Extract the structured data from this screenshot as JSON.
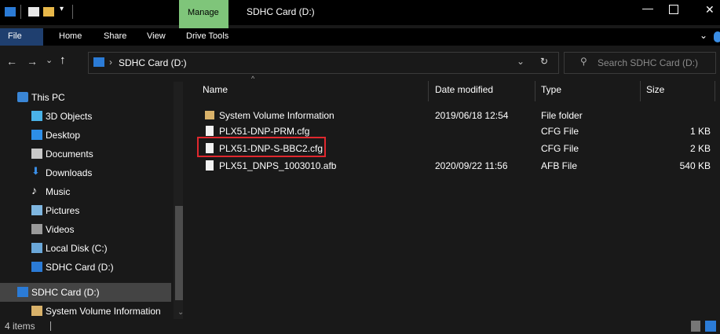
{
  "window": {
    "title": "SDHC Card (D:)",
    "manage_tab": "Manage",
    "drive_tools_tab": "Drive Tools"
  },
  "ribbon": {
    "tabs": [
      "File",
      "Home",
      "Share",
      "View"
    ]
  },
  "address": {
    "path": "SDHC Card (D:)",
    "search_placeholder": "Search SDHC Card (D:)"
  },
  "nav": {
    "this_pc": "This PC",
    "items": [
      "3D Objects",
      "Desktop",
      "Documents",
      "Downloads",
      "Music",
      "Pictures",
      "Videos",
      "Local Disk (C:)",
      "SDHC Card (D:)"
    ],
    "selected": "SDHC Card (D:)",
    "sub_item": "System Volume Information"
  },
  "columns": {
    "name": "Name",
    "date": "Date modified",
    "type": "Type",
    "size": "Size"
  },
  "files": [
    {
      "name": "System Volume Information",
      "date": "2019/06/18 12:54",
      "type": "File folder",
      "size": ""
    },
    {
      "name": "PLX51-DNP-PRM.cfg",
      "date": "",
      "type": "CFG File",
      "size": "1 KB"
    },
    {
      "name": "PLX51-DNP-S-BBC2.cfg",
      "date": "",
      "type": "CFG File",
      "size": "2 KB"
    },
    {
      "name": "PLX51_DNPS_1003010.afb",
      "date": "2020/09/22 11:56",
      "type": "AFB File",
      "size": "540 KB"
    }
  ],
  "status": {
    "items_count": "4 items"
  },
  "colors": {
    "highlight_box": "#e0282e",
    "folder": "#d9b26a",
    "manage_green": "#7fc57a",
    "selected_bg": "#444444"
  }
}
